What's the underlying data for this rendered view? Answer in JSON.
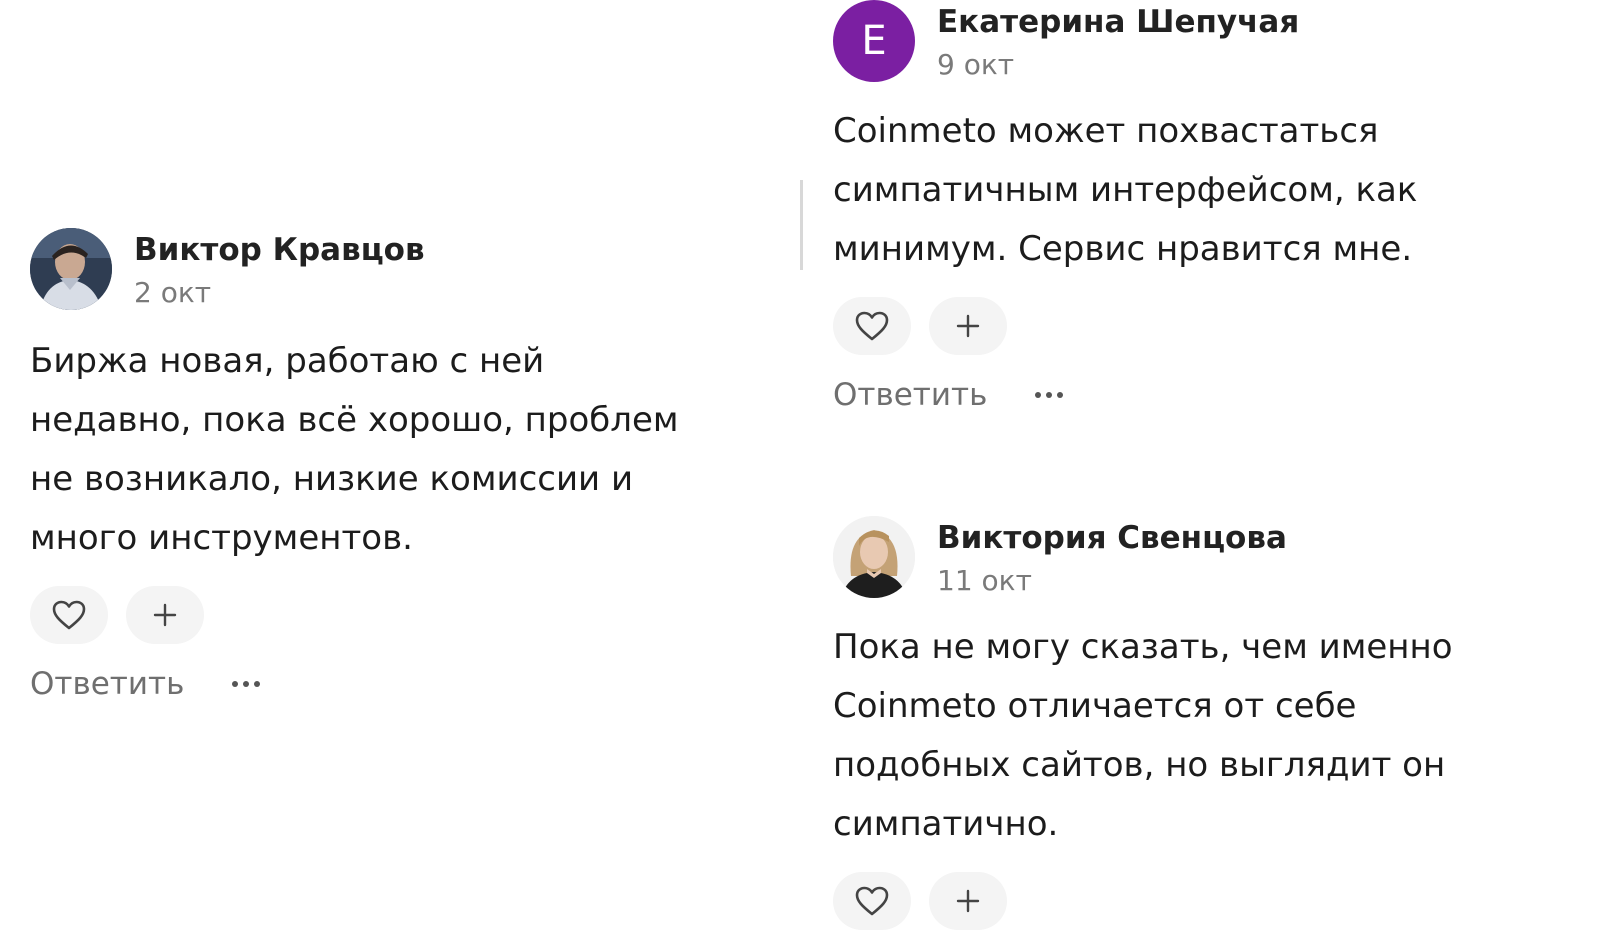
{
  "comments": [
    {
      "author": "Виктор Кравцов",
      "date": "2 окт",
      "text": "Биржа новая, работаю с ней недавно, пока всё хорошо, проблем не возникало, низкие комиссии и много инструментов.",
      "avatar": "photo",
      "reply_label": "Ответить"
    },
    {
      "author": "Екатерина Шепучая",
      "date": "9 окт",
      "text": "Coinmeto может похвастаться симпатичным интерфейсом, как минимум. Сервис нравится мне.",
      "avatar_letter": "Е",
      "avatar_color": "#7b1fa2",
      "reply_label": "Ответить"
    },
    {
      "author": "Виктория Свенцова",
      "date": "11 окт",
      "text": "Пока не могу сказать, чем именно Coinmeto отличается от себе подобных сайтов, но выглядит он симпатично.",
      "avatar": "photo"
    }
  ],
  "icons": {
    "like": "heart-icon",
    "add_reaction": "plus-icon",
    "more": "more-dots-icon"
  }
}
